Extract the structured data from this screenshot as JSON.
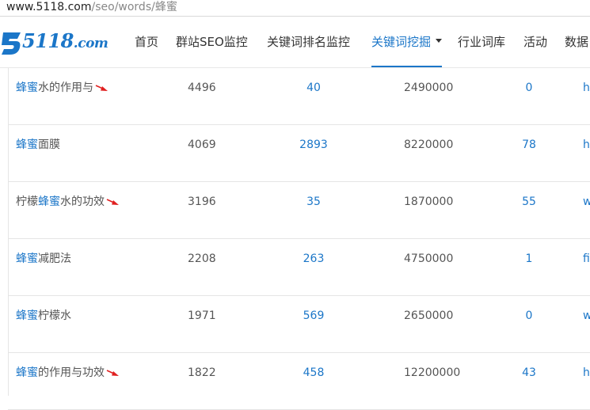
{
  "browser": {
    "url_host": "www.5118.com",
    "url_path": "/seo/words/蜂蜜"
  },
  "logo": {
    "text": "5118",
    "suffix": ".com",
    "color": "#1b76c8"
  },
  "nav": {
    "items": [
      {
        "label": "首页"
      },
      {
        "label": "群站SEO监控"
      },
      {
        "label": "关键词排名监控"
      },
      {
        "label": "关键词挖掘",
        "active": true,
        "has_dropdown": true
      },
      {
        "label": "行业词库"
      },
      {
        "label": "活动"
      },
      {
        "label": "数据"
      }
    ]
  },
  "rows": [
    {
      "kw_pre": "",
      "kw_hl": "蜂蜜",
      "kw_post": "水的作用与",
      "arrow": true,
      "c1": "4496",
      "c2": "40",
      "c3": "2490000",
      "c4": "0",
      "c5": "h"
    },
    {
      "kw_pre": "",
      "kw_hl": "蜂蜜",
      "kw_post": "面膜",
      "arrow": false,
      "c1": "4069",
      "c2": "2893",
      "c3": "8220000",
      "c4": "78",
      "c5": "h"
    },
    {
      "kw_pre": "柠檬",
      "kw_hl": "蜂蜜",
      "kw_post": "水的功效",
      "arrow": true,
      "c1": "3196",
      "c2": "35",
      "c3": "1870000",
      "c4": "55",
      "c5": "w"
    },
    {
      "kw_pre": "",
      "kw_hl": "蜂蜜",
      "kw_post": "减肥法",
      "arrow": false,
      "c1": "2208",
      "c2": "263",
      "c3": "4750000",
      "c4": "1",
      "c5": "fi"
    },
    {
      "kw_pre": "",
      "kw_hl": "蜂蜜",
      "kw_post": "柠檬水",
      "arrow": false,
      "c1": "1971",
      "c2": "569",
      "c3": "2650000",
      "c4": "0",
      "c5": "w"
    },
    {
      "kw_pre": "",
      "kw_hl": "蜂蜜",
      "kw_post": "的作用与功效",
      "arrow": true,
      "c1": "1822",
      "c2": "458",
      "c3": "12200000",
      "c4": "43",
      "c5": "h"
    }
  ],
  "colors": {
    "accent": "#1b76c8",
    "annotation_arrow": "#e02020"
  },
  "icons": {
    "logo": "5118-logo-icon",
    "annotation": "red-arrow-icon"
  }
}
